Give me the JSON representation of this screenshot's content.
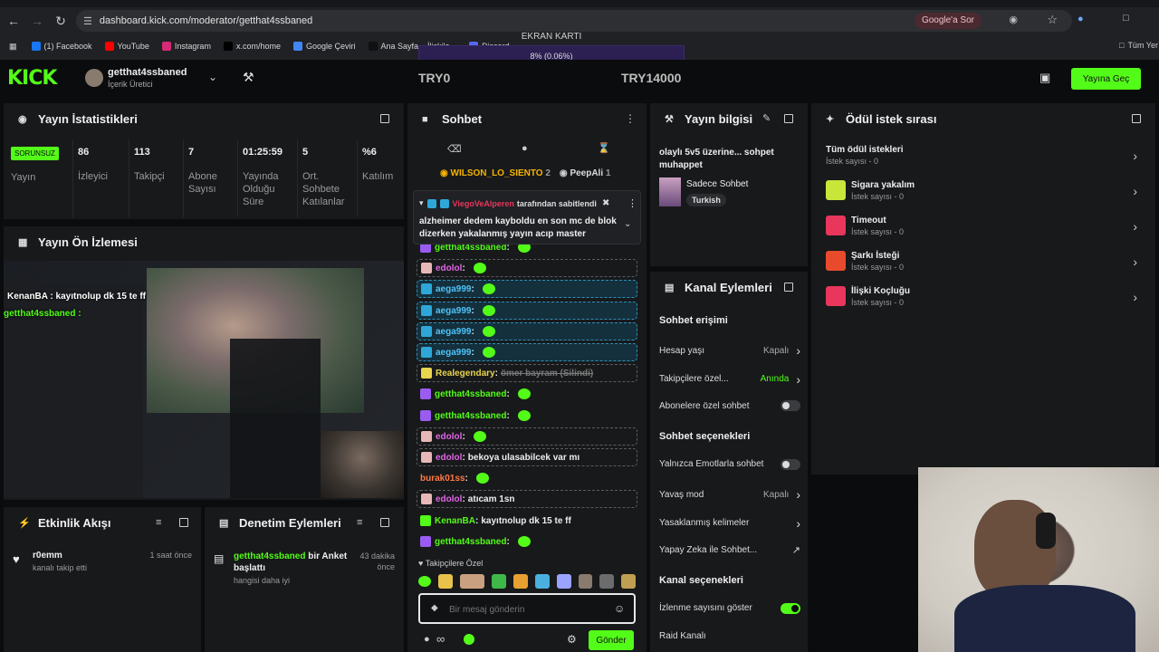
{
  "browser": {
    "url": "dashboard.kick.com/moderator/getthat4ssbaned",
    "google_sor": "Google'a Sor",
    "bookmarks": [
      {
        "label": "(1) Facebook",
        "color": "#1877f2"
      },
      {
        "label": "YouTube",
        "color": "#ff0000"
      },
      {
        "label": "Instagram",
        "color": "#d62976"
      },
      {
        "label": "x.com/home",
        "color": "#000000"
      },
      {
        "label": "Google Çeviri",
        "color": "#4285f4"
      },
      {
        "label": "Ana Sayfa – İlişkile...",
        "color": "#111111"
      },
      {
        "label": "Discord",
        "color": "#5865f2"
      }
    ],
    "all_bookmarks": "Tüm Yer"
  },
  "overlay": {
    "gpu_label": "EKRAN KARTI",
    "gpu_value": "8% (0.06%)",
    "try_left": "TRY0",
    "try_right": "TRY14000"
  },
  "header": {
    "logo": "KICK",
    "channel_name": "getthat4ssbaned",
    "channel_role": "İçerik Üretici",
    "go_live": "Yayına Geç"
  },
  "stats": {
    "title": "Yayın İstatistikleri",
    "status_badge": "SORUNSUZ",
    "status_label": "Yayın",
    "items": [
      {
        "value": "86",
        "label": "İzleyici"
      },
      {
        "value": "113",
        "label": "Takipçi"
      },
      {
        "value": "7",
        "label": "Abone Sayısı"
      },
      {
        "value": "01:25:59",
        "label": "Yayında Olduğu Süre"
      },
      {
        "value": "5",
        "label": "Ort. Sohbete Katılanlar"
      },
      {
        "value": "%6",
        "label": "Katılım"
      }
    ]
  },
  "preview": {
    "title": "Yayın Ön İzlemesi",
    "overlay_line1": "KenanBA : kayıtnolup dk 15 te ff",
    "overlay_line2": "getthat4ssbaned :"
  },
  "activity": {
    "title": "Etkinlik Akışı",
    "items": [
      {
        "user": "r0emm",
        "text": "kanalı takip etti",
        "time": "1 saat önce"
      }
    ]
  },
  "moderation": {
    "title": "Denetim Eylemleri",
    "items": [
      {
        "user": "getthat4ssbaned",
        "action": "bir Anket başlattı",
        "sub": "hangisi daha iyi",
        "time": "43 dakika önce"
      }
    ]
  },
  "chat": {
    "title": "Sohbet",
    "top_users": [
      {
        "name": "WILSON_LO_SIENTO",
        "count": "2"
      },
      {
        "name": "PeepAli",
        "count": "1"
      }
    ],
    "pinned_by": "ViegoVeAlperen",
    "pinned_suffix": "tarafından sabitlendi",
    "pinned_text": "alzheimer dedem kayboldu en son mc de blok dizerken yakalanmış yayın acıp master olaca...",
    "messages": [
      {
        "user": "getthat4ssbaned",
        "text": "",
        "color": "#53fc18",
        "style": "plain",
        "emote": true
      },
      {
        "user": "edolol",
        "text": "",
        "color": "#e065e6",
        "style": "dash",
        "emote": true
      },
      {
        "user": "aega999",
        "text": "",
        "color": "#4fc3f7",
        "style": "hl",
        "emote": true
      },
      {
        "user": "aega999",
        "text": "",
        "color": "#4fc3f7",
        "style": "hl",
        "emote": true
      },
      {
        "user": "aega999",
        "text": "",
        "color": "#4fc3f7",
        "style": "hl",
        "emote": true
      },
      {
        "user": "aega999",
        "text": "",
        "color": "#4fc3f7",
        "style": "hl",
        "emote": true
      },
      {
        "user": "Realegendary",
        "text": "ömer bayram (Silindi)",
        "color": "#e8d44d",
        "style": "dash",
        "emote": false
      },
      {
        "user": "getthat4ssbaned",
        "text": "",
        "color": "#53fc18",
        "style": "plain",
        "emote": true
      },
      {
        "user": "getthat4ssbaned",
        "text": "",
        "color": "#53fc18",
        "style": "plain",
        "emote": true
      },
      {
        "user": "edolol",
        "text": "",
        "color": "#e065e6",
        "style": "dash",
        "emote": true
      },
      {
        "user": "edolol",
        "text": "bekoya ulasabilcek var mı",
        "color": "#e065e6",
        "style": "dash",
        "emote": false
      },
      {
        "user": "burak01ss",
        "text": "",
        "color": "#ff7a45",
        "style": "plain",
        "emote": true
      },
      {
        "user": "edolol",
        "text": "atıcam 1sn",
        "color": "#e065e6",
        "style": "dash",
        "emote": false
      },
      {
        "user": "KenanBA",
        "text": "kayıtnolup dk 15 te ff",
        "color": "#53fc18",
        "style": "plain",
        "emote": false
      },
      {
        "user": "getthat4ssbaned",
        "text": "",
        "color": "#53fc18",
        "style": "plain",
        "emote": true
      }
    ],
    "followers_only": "Takipçilere Özel",
    "input_placeholder": "Bir mesaj gönderin",
    "send": "Gönder"
  },
  "stream_info": {
    "title": "Yayın bilgisi",
    "stream_title": "olaylı 5v5 üzerine... sohpet muhappet",
    "category": "Sadece Sohbet",
    "tag": "Turkish"
  },
  "channel_actions": {
    "title": "Kanal Eylemleri",
    "sections": [
      {
        "heading": "Sohbet erişimi",
        "items": [
          {
            "label": "Hesap yaşı",
            "value": "Kapalı",
            "type": "link"
          },
          {
            "label": "Takipçilere özel...",
            "value": "Anında",
            "type": "link",
            "accent": true
          },
          {
            "label": "Abonelere özel sohbet",
            "value": "",
            "type": "toggle",
            "on": false
          }
        ]
      },
      {
        "heading": "Sohbet seçenekleri",
        "items": [
          {
            "label": "Yalnızca Emotlarla sohbet",
            "value": "",
            "type": "toggle",
            "on": false
          },
          {
            "label": "Yavaş mod",
            "value": "Kapalı",
            "type": "link"
          },
          {
            "label": "Yasaklanmış kelimeler",
            "value": "",
            "type": "link"
          },
          {
            "label": "Yapay Zeka ile Sohbet...",
            "value": "",
            "type": "external"
          }
        ]
      },
      {
        "heading": "Kanal seçenekleri",
        "items": [
          {
            "label": "İzlenme sayısını göster",
            "value": "",
            "type": "toggle",
            "on": true
          },
          {
            "label": "Raid Kanalı",
            "value": "",
            "type": "none"
          }
        ]
      }
    ]
  },
  "rewards": {
    "title": "Ödül istek sırası",
    "all": {
      "title": "Tüm ödül istekleri",
      "count": "İstek sayısı - 0"
    },
    "items": [
      {
        "title": "Sigara yakalım",
        "count": "İstek sayısı - 0",
        "color": "#c8e63a"
      },
      {
        "title": "Timeout",
        "count": "İstek sayısı - 0",
        "color": "#e8365c"
      },
      {
        "title": "Şarkı İsteği",
        "count": "İstek sayısı - 0",
        "color": "#e84b2c"
      },
      {
        "title": "İlişki Koçluğu",
        "count": "İstek sayısı - 0",
        "color": "#e8365c"
      }
    ]
  }
}
